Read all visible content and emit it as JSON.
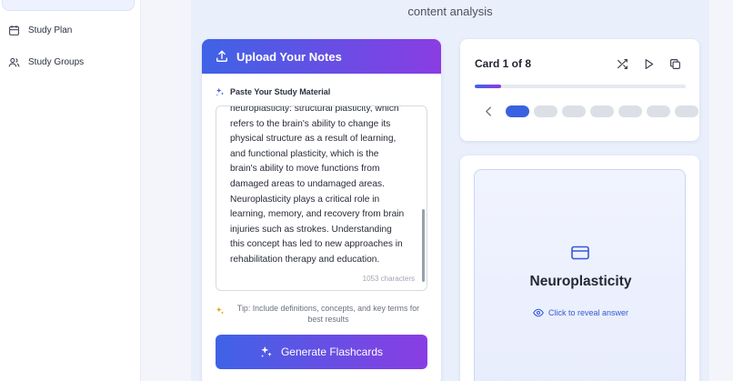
{
  "sidebar": {
    "items": [
      {
        "label": "Study Plan",
        "icon": "calendar-icon"
      },
      {
        "label": "Study Groups",
        "icon": "users-icon"
      }
    ]
  },
  "main": {
    "caption": "content analysis"
  },
  "upload": {
    "title": "Upload Your Notes",
    "paste_label": "Paste Your Study Material",
    "textarea_value": "neuroplasticity: structural plasticity, which\nrefers to the brain's ability to change its\nphysical structure as a result of learning,\nand functional plasticity, which is the\nbrain's ability to move functions from\ndamaged areas to undamaged areas.\nNeuroplasticity plays a critical role in\nlearning, memory, and recovery from brain\ninjuries such as strokes. Understanding\nthis concept has led to new approaches in\nrehabilitation therapy and education.",
    "char_count": "1053 characters",
    "tip": "Tip: Include definitions, concepts, and key terms for best results",
    "generate_label": "Generate Flashcards"
  },
  "navigator": {
    "card_count": "Card 1 of 8",
    "progress_fraction": 0.125,
    "total_cards": 8,
    "active_index": 0
  },
  "flashcard": {
    "term": "Neuroplasticity",
    "reveal_label": "Click to reveal answer"
  },
  "colors": {
    "accent_start": "#3f63e6",
    "accent_end": "#8a3de3",
    "active_dot": "#3a62e0",
    "tip_icon": "#e0a100"
  }
}
